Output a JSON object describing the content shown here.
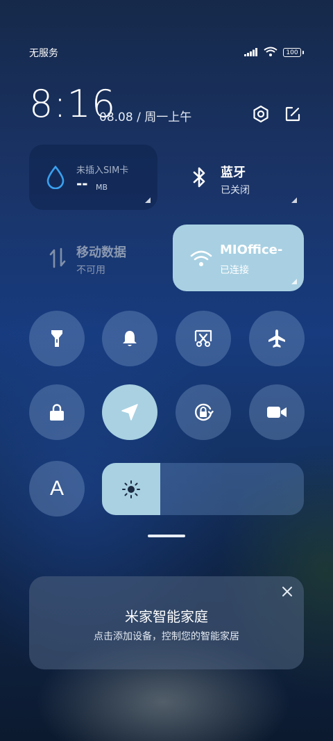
{
  "status_bar": {
    "carrier": "无服务",
    "battery": "100"
  },
  "header": {
    "time": "8:16",
    "date": "08.08 / 周一上午"
  },
  "tiles": {
    "data_usage": {
      "title": "未插入SIM卡",
      "value": "--",
      "unit": "MB"
    },
    "bluetooth": {
      "title": "蓝牙",
      "status": "已关闭"
    },
    "mobile_data": {
      "title": "移动数据",
      "status": "不可用"
    },
    "wifi": {
      "title": "MIOffice-",
      "status": "已连接"
    }
  },
  "toggles": [
    {
      "icon": "flashlight-icon",
      "active": false
    },
    {
      "icon": "bell-icon",
      "active": false
    },
    {
      "icon": "screenshot-icon",
      "active": false
    },
    {
      "icon": "airplane-icon",
      "active": false
    },
    {
      "icon": "lock-icon",
      "active": false
    },
    {
      "icon": "location-icon",
      "active": true
    },
    {
      "icon": "auto-rotate-lock-icon",
      "active": false
    },
    {
      "icon": "video-camera-icon",
      "active": false
    }
  ],
  "auto_brightness": {
    "label": "A"
  },
  "brightness": {
    "level": 0.29
  },
  "promo": {
    "title": "米家智能家庭",
    "subtitle": "点击添加设备，控制您的智能家居"
  },
  "colors": {
    "accent_active": "#a9d1e2",
    "data_icon": "#3aa0f0"
  }
}
